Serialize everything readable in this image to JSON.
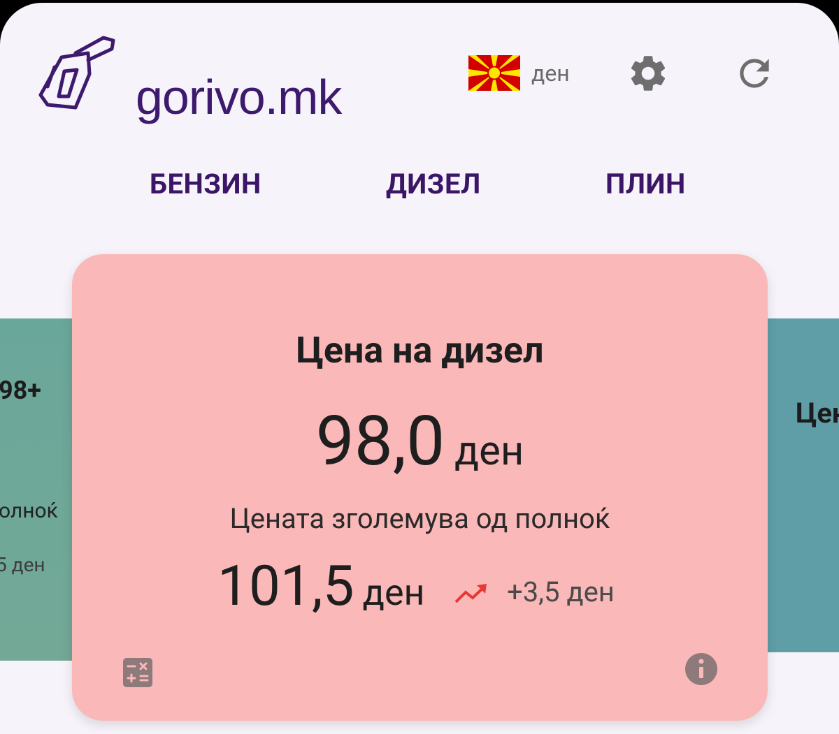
{
  "header": {
    "logo_text": "gorivo.mk",
    "currency_label": "ден",
    "icons": [
      "fuel-nozzle-icon",
      "north-macedonia-flag-icon",
      "gear-icon",
      "refresh-icon"
    ]
  },
  "tabs": [
    {
      "label": "БЕНЗИН"
    },
    {
      "label": "ДИЗЕЛ"
    },
    {
      "label": "ПЛИН"
    }
  ],
  "left_card": {
    "title_fragment": "98+",
    "label_fragment": "олноќ",
    "price_fragment": "5 ден",
    "color": "#6aa79b"
  },
  "right_card": {
    "title_fragment": "Цен",
    "color": "#5f9ea6"
  },
  "main_card": {
    "title": "Цена на дизел",
    "price": "98,0",
    "price_unit": "ден",
    "change_label": "Цената зголемува од полноќ",
    "new_price": "101,5",
    "new_price_unit": "ден",
    "delta": "+3,5 ден",
    "trend": "up",
    "color": "#fbb8b8",
    "trend_color": "#e53935",
    "icons": [
      "calculator-icon",
      "info-icon"
    ]
  },
  "colors": {
    "background": "#f7f3fa",
    "brand": "#3d1a6e",
    "tab_text": "#3b1566"
  }
}
